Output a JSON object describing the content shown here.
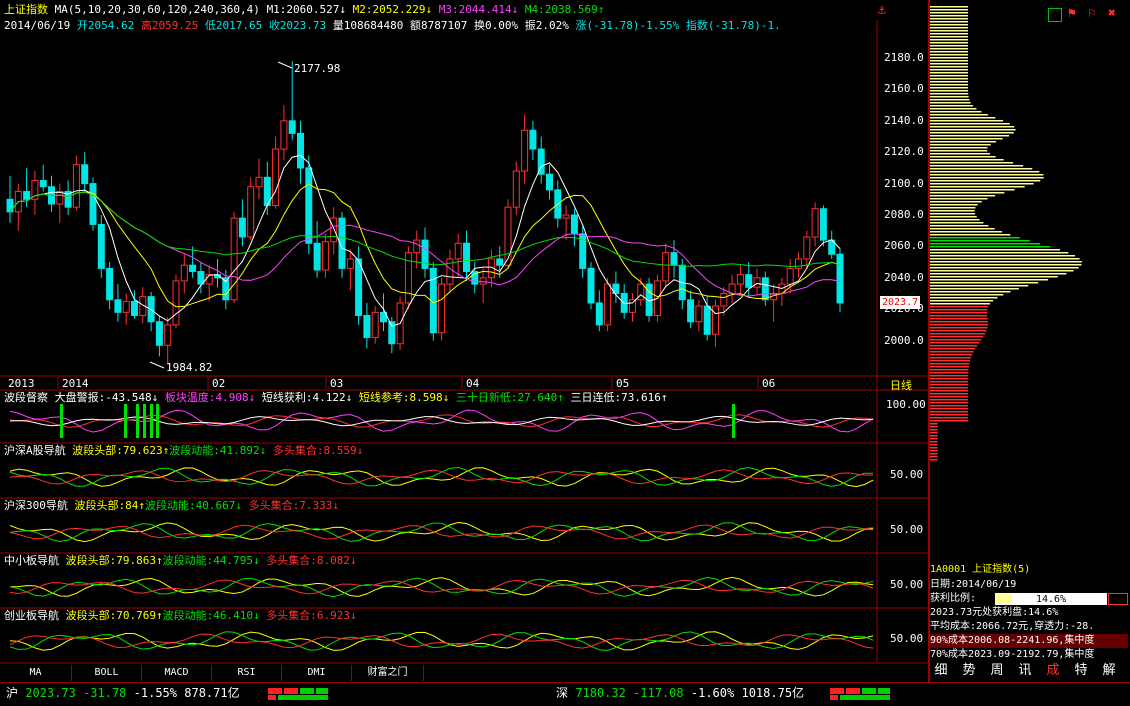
{
  "header": {
    "title": "上证指数",
    "ma_label": "MA(5,10,20,30,60,120,240,360,4)",
    "ma1": "M1:2060.527",
    "ma2": "M2:2052.229",
    "ma3": "M3:2044.414",
    "ma4": "M4:2038.569",
    "date": "2014/06/19",
    "open": "开2054.62",
    "high": "高2059.25",
    "low": "低2017.65",
    "close": "收2023.73",
    "volume": "量108684480",
    "amount": "额8787107",
    "turnover": "换0.00%",
    "amplitude": "振2.02%",
    "change": "涨(-31.78)-1.55%",
    "index_change": "指数(-31.78)-1."
  },
  "price_axis": {
    "ticks": [
      "2180.0",
      "2160.0",
      "2140.0",
      "2120.0",
      "2100.0",
      "2080.0",
      "2060.0",
      "2040.0",
      "2020.0",
      "2000.0"
    ],
    "current_price": "2023.7",
    "high_marker": "2177.98",
    "low_marker": "1984.82"
  },
  "time_axis": {
    "labels": [
      "2013",
      "2014",
      "02",
      "03",
      "04",
      "05",
      "06"
    ],
    "period": "日线"
  },
  "panels": [
    {
      "name": "波段督察",
      "items": [
        {
          "text": "大盘警报:-43.548",
          "color": "#ffffff"
        },
        {
          "text": "板块温度:4.908",
          "color": "#ff40ff"
        },
        {
          "text": "短线获利:4.122",
          "color": "#ffffff"
        },
        {
          "text": "短线参考:8.598",
          "color": "#ffff00"
        },
        {
          "text": "三十日新低:27.640",
          "color": "#00e000"
        },
        {
          "text": "三日连低:73.616",
          "color": "#ffffff"
        }
      ],
      "axis": "100.00"
    },
    {
      "name": "沪深A股导航",
      "items": [
        {
          "text": "波段头部:79.623",
          "color": "#ffff00"
        },
        {
          "text": "波段动能:41.892",
          "color": "#00e000"
        },
        {
          "text": "多头集合:8.559",
          "color": "#ff3030"
        }
      ],
      "axis": "50.00"
    },
    {
      "name": "沪深300导航",
      "items": [
        {
          "text": "波段头部:84",
          "color": "#ffff00"
        },
        {
          "text": "波段动能:40.667",
          "color": "#00e000"
        },
        {
          "text": "多头集合:7.333",
          "color": "#ff3030"
        }
      ],
      "axis": "50.00"
    },
    {
      "name": "中小板导航",
      "items": [
        {
          "text": "波段头部:79.863",
          "color": "#ffff00"
        },
        {
          "text": "波段动能:44.795",
          "color": "#00e000"
        },
        {
          "text": "多头集合:8.082",
          "color": "#ff3030"
        }
      ],
      "axis": "50.00"
    },
    {
      "name": "创业板导航",
      "items": [
        {
          "text": "波段头部:70.769",
          "color": "#ffff00"
        },
        {
          "text": "波段动能:46.410",
          "color": "#00e000"
        },
        {
          "text": "多头集合:6.923",
          "color": "#ff3030"
        }
      ],
      "axis": "50.00"
    }
  ],
  "bottom_tabs": [
    "MA",
    "BOLL",
    "MACD",
    "RSI",
    "DMI",
    "财富之门"
  ],
  "info": {
    "code": "1A0001",
    "name": "上证指数(5)",
    "date": "日期:2014/06/19",
    "profit_label": "获利比例:",
    "profit_value": "14.6%",
    "profit_line": "2023.73元处获利盘:14.6%",
    "avg_cost": "平均成本:2066.72元,穿透力:-28.",
    "cost90": "90%成本2006.08-2241.96,集中度",
    "cost70": "70%成本2023.09-2192.79,集中度"
  },
  "right_tabs": [
    "细",
    "势",
    "周",
    "讯",
    "成",
    "特",
    "解"
  ],
  "status_bar": {
    "sh_label": "沪",
    "sh_price": "2023.73",
    "sh_change": "-31.78",
    "sh_pct": "-1.55%",
    "sh_amount": "878.71亿",
    "sz_label": "深",
    "sz_price": "7180.32",
    "sz_change": "-117.08",
    "sz_pct": "-1.60%",
    "sz_amount": "1018.75亿"
  },
  "chart_data": {
    "type": "candlestick",
    "ylim": [
      1980,
      2190
    ],
    "grid": false,
    "ohlc": [
      [
        2090,
        2105,
        2075,
        2082
      ],
      [
        2082,
        2100,
        2070,
        2095
      ],
      [
        2095,
        2110,
        2085,
        2090
      ],
      [
        2090,
        2108,
        2080,
        2102
      ],
      [
        2102,
        2112,
        2095,
        2098
      ],
      [
        2098,
        2105,
        2082,
        2087
      ],
      [
        2087,
        2100,
        2075,
        2095
      ],
      [
        2095,
        2102,
        2080,
        2085
      ],
      [
        2085,
        2118,
        2083,
        2112
      ],
      [
        2112,
        2120,
        2095,
        2100
      ],
      [
        2100,
        2104,
        2070,
        2074
      ],
      [
        2074,
        2080,
        2040,
        2046
      ],
      [
        2046,
        2050,
        2020,
        2026
      ],
      [
        2026,
        2036,
        2012,
        2018
      ],
      [
        2018,
        2030,
        2010,
        2025
      ],
      [
        2025,
        2032,
        2014,
        2016
      ],
      [
        2016,
        2034,
        2011,
        2028
      ],
      [
        2028,
        2031,
        2006,
        2012
      ],
      [
        2012,
        2016,
        1990,
        1997
      ],
      [
        1997,
        2015,
        1985,
        2010
      ],
      [
        2010,
        2042,
        2008,
        2038
      ],
      [
        2038,
        2055,
        2030,
        2048
      ],
      [
        2048,
        2060,
        2040,
        2044
      ],
      [
        2044,
        2050,
        2030,
        2036
      ],
      [
        2036,
        2048,
        2025,
        2042
      ],
      [
        2042,
        2052,
        2034,
        2040
      ],
      [
        2040,
        2045,
        2020,
        2026
      ],
      [
        2026,
        2082,
        2024,
        2078
      ],
      [
        2078,
        2090,
        2060,
        2066
      ],
      [
        2066,
        2104,
        2064,
        2098
      ],
      [
        2098,
        2116,
        2090,
        2104
      ],
      [
        2104,
        2114,
        2080,
        2086
      ],
      [
        2086,
        2130,
        2084,
        2122
      ],
      [
        2122,
        2150,
        2115,
        2140
      ],
      [
        2140,
        2178,
        2128,
        2132
      ],
      [
        2132,
        2140,
        2100,
        2110
      ],
      [
        2110,
        2118,
        2055,
        2062
      ],
      [
        2062,
        2076,
        2040,
        2045
      ],
      [
        2045,
        2068,
        2040,
        2063
      ],
      [
        2063,
        2085,
        2055,
        2078
      ],
      [
        2078,
        2082,
        2040,
        2046
      ],
      [
        2046,
        2058,
        2032,
        2052
      ],
      [
        2052,
        2060,
        2010,
        2016
      ],
      [
        2016,
        2024,
        1995,
        2002
      ],
      [
        2002,
        2022,
        1998,
        2018
      ],
      [
        2018,
        2030,
        2006,
        2012
      ],
      [
        2012,
        2015,
        1992,
        1998
      ],
      [
        1998,
        2028,
        1994,
        2024
      ],
      [
        2024,
        2060,
        2020,
        2056
      ],
      [
        2056,
        2070,
        2046,
        2064
      ],
      [
        2064,
        2072,
        2040,
        2046
      ],
      [
        2046,
        2050,
        2000,
        2005
      ],
      [
        2005,
        2040,
        2000,
        2036
      ],
      [
        2036,
        2058,
        2030,
        2052
      ],
      [
        2052,
        2068,
        2040,
        2062
      ],
      [
        2062,
        2070,
        2038,
        2044
      ],
      [
        2044,
        2050,
        2030,
        2036
      ],
      [
        2036,
        2046,
        2024,
        2040
      ],
      [
        2040,
        2058,
        2034,
        2052
      ],
      [
        2052,
        2060,
        2040,
        2048
      ],
      [
        2048,
        2090,
        2046,
        2085
      ],
      [
        2085,
        2114,
        2080,
        2108
      ],
      [
        2108,
        2144,
        2100,
        2134
      ],
      [
        2134,
        2140,
        2115,
        2122
      ],
      [
        2122,
        2130,
        2100,
        2106
      ],
      [
        2106,
        2112,
        2090,
        2096
      ],
      [
        2096,
        2102,
        2072,
        2078
      ],
      [
        2078,
        2086,
        2064,
        2080
      ],
      [
        2080,
        2084,
        2060,
        2068
      ],
      [
        2068,
        2074,
        2040,
        2046
      ],
      [
        2046,
        2050,
        2020,
        2024
      ],
      [
        2024,
        2032,
        2006,
        2010
      ],
      [
        2010,
        2040,
        2006,
        2036
      ],
      [
        2036,
        2044,
        2024,
        2030
      ],
      [
        2030,
        2036,
        2014,
        2018
      ],
      [
        2018,
        2030,
        2012,
        2026
      ],
      [
        2026,
        2040,
        2022,
        2036
      ],
      [
        2036,
        2040,
        2012,
        2016
      ],
      [
        2016,
        2042,
        2012,
        2038
      ],
      [
        2038,
        2062,
        2034,
        2056
      ],
      [
        2056,
        2064,
        2040,
        2048
      ],
      [
        2048,
        2052,
        2020,
        2026
      ],
      [
        2026,
        2032,
        2008,
        2012
      ],
      [
        2012,
        2026,
        2006,
        2022
      ],
      [
        2022,
        2028,
        2000,
        2004
      ],
      [
        2004,
        2026,
        1996,
        2022
      ],
      [
        2022,
        2034,
        2016,
        2030
      ],
      [
        2030,
        2042,
        2024,
        2036
      ],
      [
        2036,
        2048,
        2030,
        2042
      ],
      [
        2042,
        2050,
        2028,
        2034
      ],
      [
        2034,
        2046,
        2030,
        2040
      ],
      [
        2040,
        2044,
        2022,
        2026
      ],
      [
        2026,
        2036,
        2012,
        2030
      ],
      [
        2030,
        2040,
        2022,
        2036
      ],
      [
        2036,
        2052,
        2030,
        2046
      ],
      [
        2046,
        2056,
        2040,
        2052
      ],
      [
        2052,
        2070,
        2046,
        2066
      ],
      [
        2066,
        2088,
        2060,
        2084
      ],
      [
        2084,
        2086,
        2060,
        2064
      ],
      [
        2064,
        2070,
        2052,
        2055
      ],
      [
        2055,
        2059,
        2018,
        2024
      ]
    ]
  }
}
